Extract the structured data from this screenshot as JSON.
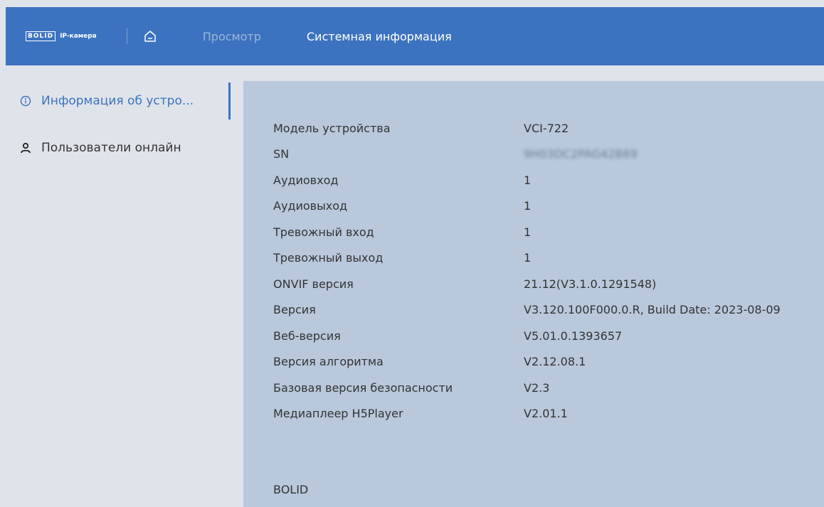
{
  "header": {
    "logo_mark": "BOLID",
    "logo_sub": "IP-камера",
    "home_icon": "home-icon",
    "tabs": [
      {
        "label": "Просмотр",
        "active": false
      },
      {
        "label": "Системная информация",
        "active": true
      }
    ],
    "color": "#3c73c0"
  },
  "sidebar": {
    "items": [
      {
        "label": "Информация об устро...",
        "icon": "info-icon",
        "active": true
      },
      {
        "label": "Пользователи онлайн",
        "icon": "user-icon",
        "active": false
      }
    ]
  },
  "device_info": {
    "rows": [
      {
        "label": "Модель устройства",
        "value": "VCI-722"
      },
      {
        "label": "SN",
        "value": "9H03DC2PAG42B69",
        "blurred": true
      },
      {
        "label": "Аудиовход",
        "value": "1"
      },
      {
        "label": "Аудиовыход",
        "value": "1"
      },
      {
        "label": "Тревожный вход",
        "value": "1"
      },
      {
        "label": "Тревожный выход",
        "value": "1"
      },
      {
        "label": "ONVIF версия",
        "value": "21.12(V3.1.0.1291548)"
      },
      {
        "label": "Версия",
        "value": "V3.120.100F000.0.R, Build Date: 2023-08-09"
      },
      {
        "label": "Веб-версия",
        "value": "V5.01.0.1393657"
      },
      {
        "label": "Версия алгоритма",
        "value": "V2.12.08.1"
      },
      {
        "label": "Базовая версия безопасности",
        "value": "V2.3"
      },
      {
        "label": "Медиаплеер H5Player",
        "value": "V2.01.1"
      }
    ],
    "footer": "BOLID"
  }
}
